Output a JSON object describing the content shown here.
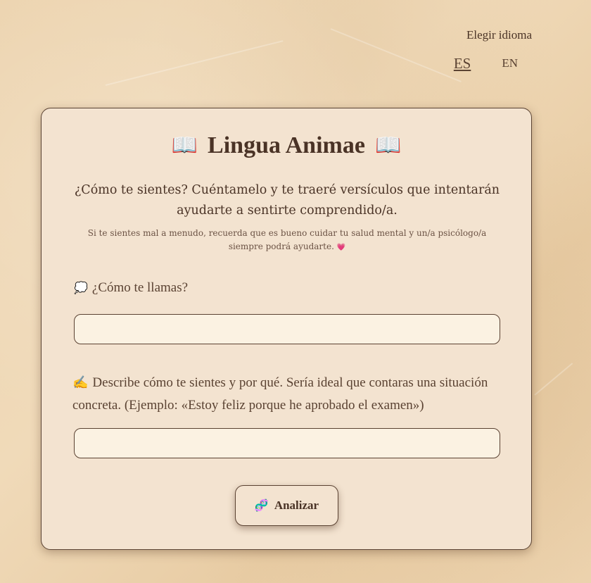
{
  "language": {
    "title": "Elegir idioma",
    "options": [
      "ES",
      "EN"
    ],
    "selected": "ES"
  },
  "card": {
    "title": "Lingua Animae",
    "title_icon": "📖",
    "subtitle": "¿Cómo te sientes? Cuéntamelo y te traeré versículos que intentarán ayudarte a sentirte comprendido/a.",
    "note": "Si te sientes mal a menudo, recuerda que es bueno cuidar tu salud mental y un/a psicólogo/a siempre podrá ayudarte.",
    "note_icon": "💗"
  },
  "form": {
    "name_icon": "💭",
    "name_label": "¿Cómo te llamas?",
    "name_value": "",
    "feel_icon": "✍️",
    "feel_label": "Describe cómo te sientes y por qué. Sería ideal que contaras una situación concreta. (Ejemplo: «Estoy feliz porque he aprobado el examen»)",
    "feel_value": "",
    "submit_icon": "🧬",
    "submit_label": "Analizar"
  }
}
